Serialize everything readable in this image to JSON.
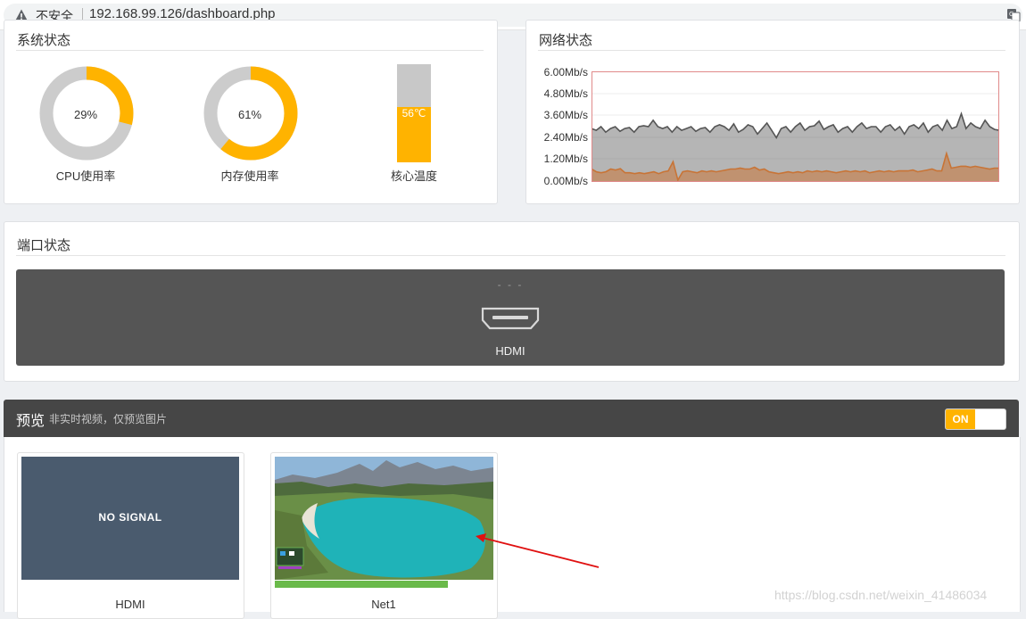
{
  "browser": {
    "insecure_label": "不安全",
    "url": "192.168.99.126/dashboard.php"
  },
  "system_status": {
    "title": "系统状态",
    "cpu": {
      "value": "29%",
      "percent": 29,
      "label": "CPU使用率"
    },
    "memory": {
      "value": "61%",
      "percent": 61,
      "label": "内存使用率"
    },
    "temperature": {
      "value": "56℃",
      "level": 0.56,
      "label": "核心温度"
    }
  },
  "network_status": {
    "title": "网络状态",
    "chart_data": {
      "type": "area",
      "title": "",
      "xlabel": "",
      "ylabel": "",
      "ylim": [
        0,
        6
      ],
      "y_ticks": [
        "6.00Mb/s",
        "4.80Mb/s",
        "3.60Mb/s",
        "2.40Mb/s",
        "1.20Mb/s",
        "0.00Mb/s"
      ],
      "series": [
        {
          "color": "#555555",
          "values": [
            2.9,
            2.8,
            3.0,
            2.7,
            2.9,
            3.0,
            2.75,
            2.9,
            2.95,
            2.7,
            3.0,
            3.05,
            3.0,
            3.35,
            3.0,
            2.9,
            3.0,
            2.7,
            3.0,
            2.8,
            2.9,
            3.0,
            2.75,
            2.9,
            2.95,
            2.7,
            3.0,
            3.1,
            3.0,
            2.8,
            3.15,
            2.7,
            2.85,
            3.1,
            3.0,
            2.6,
            2.9,
            3.2,
            2.8,
            2.4,
            2.9,
            3.0,
            2.7,
            3.0,
            3.2,
            2.8,
            3.0,
            3.05,
            3.3,
            2.85,
            3.0,
            3.1,
            2.7,
            2.9,
            3.0,
            2.7,
            3.0,
            3.2,
            2.9,
            3.0,
            3.0,
            2.7,
            3.0,
            3.1,
            2.8,
            3.0,
            2.6,
            3.0,
            3.1,
            2.9,
            3.2,
            2.7,
            3.0,
            3.1,
            2.8,
            3.35,
            2.9,
            3.0,
            3.7,
            2.9,
            3.2,
            3.0,
            2.9,
            3.35,
            3.0,
            2.85,
            2.8
          ]
        },
        {
          "color": "#c87436",
          "values": [
            0.7,
            0.55,
            0.5,
            0.55,
            0.7,
            0.65,
            0.72,
            0.5,
            0.5,
            0.45,
            0.5,
            0.45,
            0.5,
            0.55,
            0.45,
            0.55,
            0.6,
            1.1,
            0.1,
            0.55,
            0.6,
            0.55,
            0.5,
            0.6,
            0.55,
            0.6,
            0.55,
            0.6,
            0.65,
            0.7,
            0.7,
            0.75,
            0.7,
            0.7,
            0.8,
            0.65,
            0.7,
            0.55,
            0.5,
            0.45,
            0.5,
            0.55,
            0.5,
            0.55,
            0.5,
            0.6,
            0.55,
            0.6,
            0.55,
            0.6,
            0.55,
            0.5,
            0.55,
            0.6,
            0.55,
            0.6,
            0.55,
            0.6,
            0.5,
            0.55,
            0.6,
            0.55,
            0.6,
            0.55,
            0.6,
            0.6,
            0.6,
            0.65,
            0.55,
            0.6,
            0.65,
            0.7,
            0.6,
            0.6,
            1.55,
            0.75,
            0.8,
            0.85,
            0.85,
            0.8,
            0.85,
            0.8,
            0.75,
            0.7,
            0.75,
            0.75
          ]
        }
      ]
    }
  },
  "port_status": {
    "title": "端口状态",
    "dashes": "- - -",
    "port_label": "HDMI"
  },
  "preview": {
    "title": "预览",
    "subtitle": "非实时视频，仅预览图片",
    "toggle_label": "ON",
    "items": [
      {
        "screen_text": "NO SIGNAL",
        "name": "HDMI"
      },
      {
        "name": "Net1"
      }
    ]
  },
  "watermark": "https://blog.csdn.net/weixin_41486034"
}
